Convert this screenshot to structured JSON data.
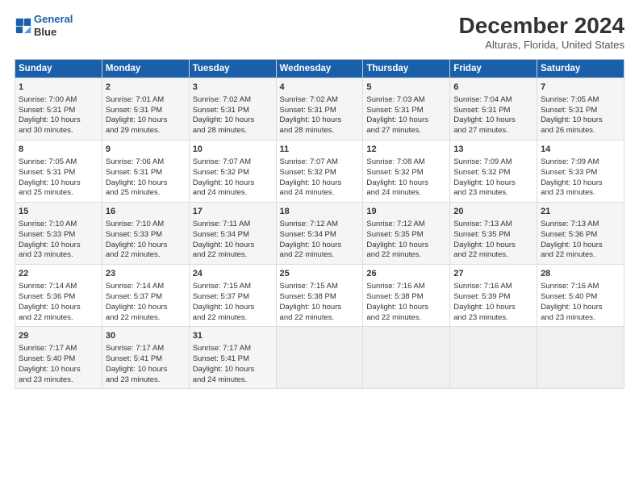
{
  "header": {
    "logo_line1": "General",
    "logo_line2": "Blue",
    "title": "December 2024",
    "subtitle": "Alturas, Florida, United States"
  },
  "days_of_week": [
    "Sunday",
    "Monday",
    "Tuesday",
    "Wednesday",
    "Thursday",
    "Friday",
    "Saturday"
  ],
  "weeks": [
    [
      {
        "day": "1",
        "lines": [
          "Sunrise: 7:00 AM",
          "Sunset: 5:31 PM",
          "Daylight: 10 hours",
          "and 30 minutes."
        ]
      },
      {
        "day": "2",
        "lines": [
          "Sunrise: 7:01 AM",
          "Sunset: 5:31 PM",
          "Daylight: 10 hours",
          "and 29 minutes."
        ]
      },
      {
        "day": "3",
        "lines": [
          "Sunrise: 7:02 AM",
          "Sunset: 5:31 PM",
          "Daylight: 10 hours",
          "and 28 minutes."
        ]
      },
      {
        "day": "4",
        "lines": [
          "Sunrise: 7:02 AM",
          "Sunset: 5:31 PM",
          "Daylight: 10 hours",
          "and 28 minutes."
        ]
      },
      {
        "day": "5",
        "lines": [
          "Sunrise: 7:03 AM",
          "Sunset: 5:31 PM",
          "Daylight: 10 hours",
          "and 27 minutes."
        ]
      },
      {
        "day": "6",
        "lines": [
          "Sunrise: 7:04 AM",
          "Sunset: 5:31 PM",
          "Daylight: 10 hours",
          "and 27 minutes."
        ]
      },
      {
        "day": "7",
        "lines": [
          "Sunrise: 7:05 AM",
          "Sunset: 5:31 PM",
          "Daylight: 10 hours",
          "and 26 minutes."
        ]
      }
    ],
    [
      {
        "day": "8",
        "lines": [
          "Sunrise: 7:05 AM",
          "Sunset: 5:31 PM",
          "Daylight: 10 hours",
          "and 25 minutes."
        ]
      },
      {
        "day": "9",
        "lines": [
          "Sunrise: 7:06 AM",
          "Sunset: 5:31 PM",
          "Daylight: 10 hours",
          "and 25 minutes."
        ]
      },
      {
        "day": "10",
        "lines": [
          "Sunrise: 7:07 AM",
          "Sunset: 5:32 PM",
          "Daylight: 10 hours",
          "and 24 minutes."
        ]
      },
      {
        "day": "11",
        "lines": [
          "Sunrise: 7:07 AM",
          "Sunset: 5:32 PM",
          "Daylight: 10 hours",
          "and 24 minutes."
        ]
      },
      {
        "day": "12",
        "lines": [
          "Sunrise: 7:08 AM",
          "Sunset: 5:32 PM",
          "Daylight: 10 hours",
          "and 24 minutes."
        ]
      },
      {
        "day": "13",
        "lines": [
          "Sunrise: 7:09 AM",
          "Sunset: 5:32 PM",
          "Daylight: 10 hours",
          "and 23 minutes."
        ]
      },
      {
        "day": "14",
        "lines": [
          "Sunrise: 7:09 AM",
          "Sunset: 5:33 PM",
          "Daylight: 10 hours",
          "and 23 minutes."
        ]
      }
    ],
    [
      {
        "day": "15",
        "lines": [
          "Sunrise: 7:10 AM",
          "Sunset: 5:33 PM",
          "Daylight: 10 hours",
          "and 23 minutes."
        ]
      },
      {
        "day": "16",
        "lines": [
          "Sunrise: 7:10 AM",
          "Sunset: 5:33 PM",
          "Daylight: 10 hours",
          "and 22 minutes."
        ]
      },
      {
        "day": "17",
        "lines": [
          "Sunrise: 7:11 AM",
          "Sunset: 5:34 PM",
          "Daylight: 10 hours",
          "and 22 minutes."
        ]
      },
      {
        "day": "18",
        "lines": [
          "Sunrise: 7:12 AM",
          "Sunset: 5:34 PM",
          "Daylight: 10 hours",
          "and 22 minutes."
        ]
      },
      {
        "day": "19",
        "lines": [
          "Sunrise: 7:12 AM",
          "Sunset: 5:35 PM",
          "Daylight: 10 hours",
          "and 22 minutes."
        ]
      },
      {
        "day": "20",
        "lines": [
          "Sunrise: 7:13 AM",
          "Sunset: 5:35 PM",
          "Daylight: 10 hours",
          "and 22 minutes."
        ]
      },
      {
        "day": "21",
        "lines": [
          "Sunrise: 7:13 AM",
          "Sunset: 5:36 PM",
          "Daylight: 10 hours",
          "and 22 minutes."
        ]
      }
    ],
    [
      {
        "day": "22",
        "lines": [
          "Sunrise: 7:14 AM",
          "Sunset: 5:36 PM",
          "Daylight: 10 hours",
          "and 22 minutes."
        ]
      },
      {
        "day": "23",
        "lines": [
          "Sunrise: 7:14 AM",
          "Sunset: 5:37 PM",
          "Daylight: 10 hours",
          "and 22 minutes."
        ]
      },
      {
        "day": "24",
        "lines": [
          "Sunrise: 7:15 AM",
          "Sunset: 5:37 PM",
          "Daylight: 10 hours",
          "and 22 minutes."
        ]
      },
      {
        "day": "25",
        "lines": [
          "Sunrise: 7:15 AM",
          "Sunset: 5:38 PM",
          "Daylight: 10 hours",
          "and 22 minutes."
        ]
      },
      {
        "day": "26",
        "lines": [
          "Sunrise: 7:16 AM",
          "Sunset: 5:38 PM",
          "Daylight: 10 hours",
          "and 22 minutes."
        ]
      },
      {
        "day": "27",
        "lines": [
          "Sunrise: 7:16 AM",
          "Sunset: 5:39 PM",
          "Daylight: 10 hours",
          "and 23 minutes."
        ]
      },
      {
        "day": "28",
        "lines": [
          "Sunrise: 7:16 AM",
          "Sunset: 5:40 PM",
          "Daylight: 10 hours",
          "and 23 minutes."
        ]
      }
    ],
    [
      {
        "day": "29",
        "lines": [
          "Sunrise: 7:17 AM",
          "Sunset: 5:40 PM",
          "Daylight: 10 hours",
          "and 23 minutes."
        ]
      },
      {
        "day": "30",
        "lines": [
          "Sunrise: 7:17 AM",
          "Sunset: 5:41 PM",
          "Daylight: 10 hours",
          "and 23 minutes."
        ]
      },
      {
        "day": "31",
        "lines": [
          "Sunrise: 7:17 AM",
          "Sunset: 5:41 PM",
          "Daylight: 10 hours",
          "and 24 minutes."
        ]
      },
      {
        "day": "",
        "lines": []
      },
      {
        "day": "",
        "lines": []
      },
      {
        "day": "",
        "lines": []
      },
      {
        "day": "",
        "lines": []
      }
    ]
  ]
}
